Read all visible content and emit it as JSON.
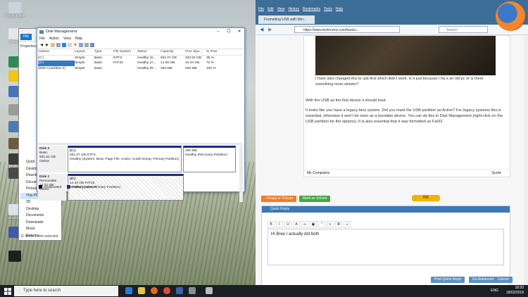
{
  "desktop": {
    "icons": [
      {
        "label": "Recycle Bin",
        "color": "#c9d4dc"
      },
      {
        "label": "iTunes",
        "color": "#e6e6e6"
      },
      {
        "label": "",
        "color": "#2e8b57"
      },
      {
        "label": "",
        "color": "#f0c419"
      },
      {
        "label": "",
        "color": "#4a74b8"
      },
      {
        "label": "",
        "color": "#9b9b9b"
      },
      {
        "label": "",
        "color": "#4e7ab5"
      },
      {
        "label": "",
        "color": "#6c5b3f"
      },
      {
        "label": "",
        "color": "#3c3c3c"
      },
      {
        "label": "",
        "color": "#4a4a4a"
      },
      {
        "label": "pluisklep",
        "color": "#d8e3ec"
      },
      {
        "label": "",
        "color": "#3f58a8"
      },
      {
        "label": "",
        "color": "#1f1f1f"
      }
    ]
  },
  "explorer": {
    "file_tab": "File",
    "properties": "Properties",
    "nav": [
      "Quick",
      "Desktop",
      "Downloads",
      "Documents",
      "Pictures",
      "This PC",
      "3D",
      "Desktop",
      "Documents",
      "Downloads",
      "Music",
      "Pictures",
      "Videos",
      "Local Disk (C:)"
    ],
    "status": "11 items    1 item selected"
  },
  "disk_management": {
    "title": "Disk Management",
    "menu": [
      "File",
      "Action",
      "View",
      "Help"
    ],
    "columns": [
      "Volume",
      "Layout",
      "Type",
      "File System",
      "Status",
      "Capacity",
      "Free Spa...",
      "% Free"
    ],
    "rows": [
      [
        "(C:)",
        "Simple",
        "Basic",
        "NTFS",
        "Healthy (S...",
        "931.07 GB",
        "332.62 GB",
        "35 %"
      ],
      [
        "(D:)",
        "Simple",
        "Basic",
        "FAT32",
        "Healthy (A...",
        "14.30 GB",
        "10.34 GB",
        "72 %"
      ],
      [
        "(Disk 0 partition 2)",
        "Simple",
        "Basic",
        "",
        "Healthy (R...",
        "450 MB",
        "450 MB",
        "100 %"
      ]
    ],
    "disks": [
      {
        "name": "Disk 0",
        "type": "Basic",
        "size": "931.51 GB",
        "state": "Online",
        "partitions": [
          {
            "title": "(C:)",
            "detail": "931.07 GB NTFS",
            "status": "Healthy (System, Boot, Page File, Active, Crash Dump, Primary Partition)"
          },
          {
            "title": "",
            "detail": "450 MB",
            "status": "Healthy (Recovery Partition)"
          }
        ]
      },
      {
        "name": "Disk 1",
        "type": "Removable",
        "size": "14.32 GB",
        "state": "Online",
        "partitions": [
          {
            "title": "(D:)",
            "detail": "14.32 GB FAT32",
            "status": "Healthy (Active, Primary Partition)"
          }
        ]
      }
    ],
    "legend": {
      "unallocated": "Unallocated",
      "primary": "Primary partition"
    }
  },
  "firefox": {
    "menu": [
      "File",
      "Edit",
      "View",
      "History",
      "Bookmarks",
      "Tools",
      "Help"
    ],
    "tab_title": "Formatting USB with Win...",
    "url": "https://www.tenforums.com/backu...",
    "search_placeholder": "Search",
    "post": {
      "quote": "I have also changed this to usb first which didn't work. Is it just because I ha e an old pc or is there something more sinister?",
      "paragraphs": [
        "With the USB as the first device it should boot.",
        "It looks like you have a legacy bios system. Did you mark the USB partition as Active? For legacy systems this is essential, otherwise it won't be seen as a bootable device. You can do this in Disk Management (right-click on the USB partition for the options). It is also essential that it was formatted as Fat32."
      ],
      "footer_left": "My Computers",
      "quote_btn": "Quote"
    },
    "fix_badge": "FIX",
    "reply_btn": "+ Reply to Thread",
    "solved_btn": "Mark as Solved",
    "quick_reply": {
      "title": "Quick Reply",
      "text": "Hi Bree I actually did both",
      "post_btn": "Post Quick Reply",
      "advanced_btn": "Go Advanced",
      "cancel_btn": "Cancel"
    }
  },
  "taskbar": {
    "search_placeholder": "Type here to search",
    "time": "18:20",
    "date": "18/02/2018",
    "lang": "ENG"
  }
}
